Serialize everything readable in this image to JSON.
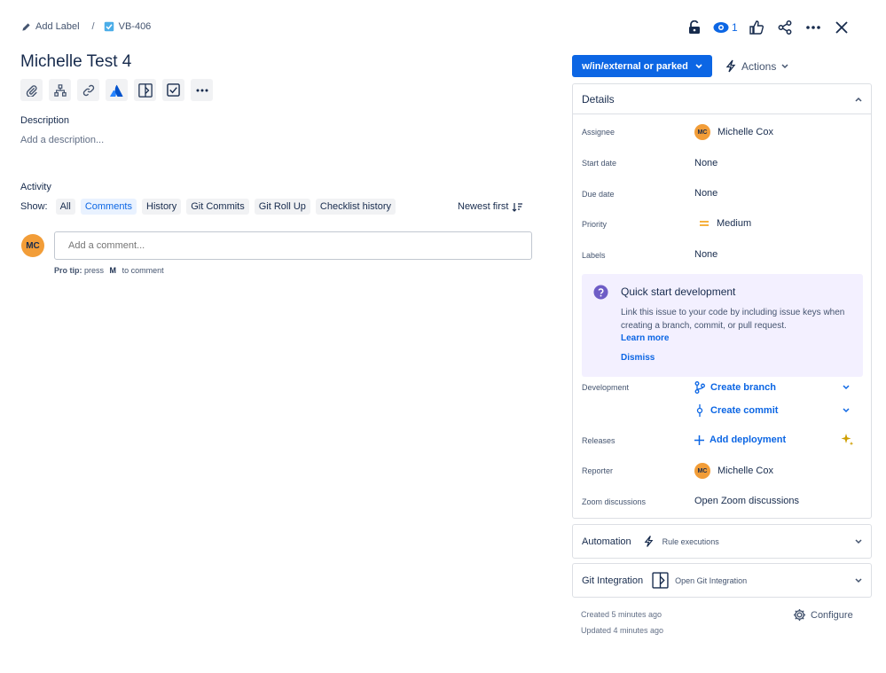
{
  "breadcrumb": {
    "add_label": "Add Label",
    "separator": "/",
    "issue_key": "VB-406"
  },
  "top_icons": {
    "watch_count": "1"
  },
  "issue": {
    "title": "Michelle Test 4"
  },
  "description": {
    "label": "Description",
    "placeholder": "Add a description..."
  },
  "activity": {
    "label": "Activity",
    "show_label": "Show:",
    "filters": [
      "All",
      "Comments",
      "History",
      "Git Commits",
      "Git Roll Up",
      "Checklist history"
    ],
    "active_filter": "Comments",
    "sort_label": "Newest first"
  },
  "comment": {
    "avatar_initials": "MC",
    "placeholder": "Add a comment...",
    "protip_prefix": "Pro tip:",
    "protip_press": "press",
    "protip_key": "M",
    "protip_suffix": "to comment"
  },
  "status": {
    "label": "w/in/external or parked",
    "actions_label": "Actions"
  },
  "details": {
    "header": "Details",
    "assignee_label": "Assignee",
    "assignee_initials": "MC",
    "assignee_name": "Michelle Cox",
    "start_label": "Start date",
    "start_value": "None",
    "due_label": "Due date",
    "due_value": "None",
    "priority_label": "Priority",
    "priority_value": "Medium",
    "labels_label": "Labels",
    "labels_value": "None",
    "quickstart": {
      "title": "Quick start development",
      "text": "Link this issue to your code by including issue keys when creating a branch, commit, or pull request.",
      "learn_more": "Learn more",
      "dismiss": "Dismiss"
    },
    "development_label": "Development",
    "create_branch": "Create branch",
    "create_commit": "Create commit",
    "releases_label": "Releases",
    "add_deployment": "Add deployment",
    "reporter_label": "Reporter",
    "reporter_initials": "MC",
    "reporter_name": "Michelle Cox",
    "zoom_label": "Zoom discussions",
    "zoom_value": "Open Zoom discussions"
  },
  "automation": {
    "name": "Automation",
    "sub": "Rule executions"
  },
  "git_integration": {
    "name": "Git Integration",
    "sub": "Open Git Integration"
  },
  "footer": {
    "created": "Created 5 minutes ago",
    "updated": "Updated 4 minutes ago",
    "configure": "Configure"
  },
  "colors": {
    "primary": "#0c66e4",
    "avatar": "#f29d38",
    "quickstart_bg": "#f3f0ff",
    "priority_medium": "#f5a623"
  }
}
